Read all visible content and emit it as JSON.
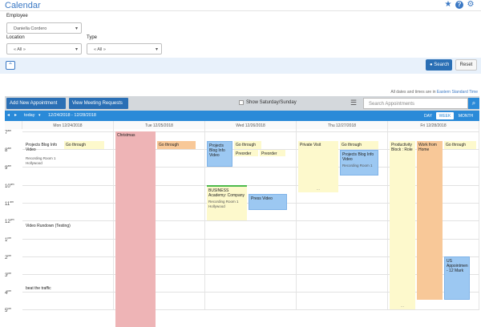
{
  "app": {
    "title": "Calendar"
  },
  "top_icons": [
    {
      "name": "star-icon",
      "glyph": "★"
    },
    {
      "name": "help-icon",
      "glyph": "?"
    },
    {
      "name": "gear-icon",
      "glyph": "⚙"
    }
  ],
  "filters": {
    "employee_label": "Employee",
    "employee_value": "Daniella Cordero",
    "location_label": "Location",
    "location_value": "« All »",
    "type_label": "Type",
    "type_value": "« All »"
  },
  "actions": {
    "search_label": "Search",
    "reset_label": "Reset"
  },
  "timezone": {
    "prefix": "All dates and times are in",
    "zone": "Eastern Standard Time"
  },
  "toolbar": {
    "add_label": "Add New Appointment",
    "view_requests_label": "View Meeting Requests",
    "show_weekend_label": "Show Saturday/Sunday",
    "search_placeholder": "Search Appointments"
  },
  "calbar": {
    "today_label": "today",
    "date_range": "12/24/2018 - 12/28/2018",
    "views": [
      "DAY",
      "WEEK",
      "MONTH"
    ],
    "active_view": "WEEK"
  },
  "days": [
    "Mon 12/24/2018",
    "Tue 12/25/2018",
    "Wed 12/26/2018",
    "Thu 12/27/2018",
    "Fri 12/28/2018"
  ],
  "hours": [
    {
      "h": "7",
      "ap": "am"
    },
    {
      "h": "8",
      "ap": "am"
    },
    {
      "h": "9",
      "ap": "am"
    },
    {
      "h": "10",
      "ap": "am"
    },
    {
      "h": "11",
      "ap": "am"
    },
    {
      "h": "12",
      "ap": "pm"
    },
    {
      "h": "1",
      "ap": "pm"
    },
    {
      "h": "2",
      "ap": "pm"
    },
    {
      "h": "3",
      "ap": "pm"
    },
    {
      "h": "4",
      "ap": "pm"
    },
    {
      "h": "5",
      "ap": "pm"
    }
  ],
  "events": {
    "mon_projects": "Projects Blog Info Video",
    "mon_go": "Go through",
    "mon_recording": "Recording Room 1 Hollywood",
    "mon_rundown": "Video Rundown (Testing)",
    "mon_beat": "beat the traffic",
    "tue_christmas": "Christmas",
    "tue_go": "Go through",
    "wed_projects": "Projects Blog Info Video",
    "wed_go": "Go through",
    "wed_preorder1": "Preorder",
    "wed_preorder2": "Preorder",
    "wed_business": "BUSINESS Academy: Company",
    "wed_business_sub": "Recording Room 1 Hollywood",
    "wed_press": "Press Video",
    "thu_private": "Private Visit",
    "thu_go": "Go through",
    "thu_projects": "Projects Blog Info Video",
    "thu_projects_sub": "Recording Room 1",
    "fri_productivity": "Productivity Block : Role",
    "fri_wfh": "Work from Home",
    "fri_go": "Go through",
    "fri_us": "US Appointmen - 12 Mark",
    "more": "..."
  }
}
